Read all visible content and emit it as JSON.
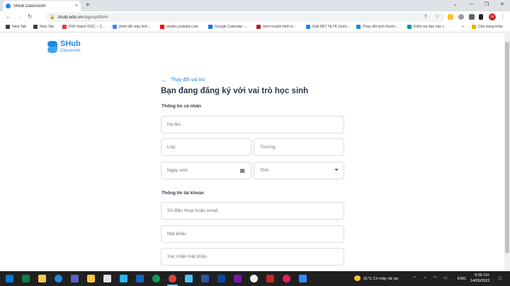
{
  "browser": {
    "tab_title": "SHub Classroom",
    "tab_close": "×",
    "new_tab": "+",
    "window_minimize": "—",
    "window_restore": "❐",
    "window_close": "✕",
    "tab_menu": "⌄",
    "url_host": "shub.edu.vn",
    "url_path": "/signup/form",
    "avatar_letter": "H",
    "bookmarks": [
      {
        "label": "New Tab",
        "icon": "globe-icon",
        "color": "#3c4043"
      },
      {
        "label": "New Tab",
        "icon": "globe-icon",
        "color": "#3c4043"
      },
      {
        "label": "PDF thành DOC – C...",
        "icon": "pdf-icon",
        "color": "#e53935"
      },
      {
        "label": "phím tắt máy tính...",
        "icon": "google-icon",
        "color": "#4285f4"
      },
      {
        "label": "studio.youtube.com",
        "icon": "youtube-icon",
        "color": "#ff0000"
      },
      {
        "label": "Google Calendar -...",
        "icon": "calendar-icon",
        "color": "#1a73e8"
      },
      {
        "label": "Xem truyện hình tr...",
        "icon": "book-icon",
        "color": "#b71c1c"
      },
      {
        "label": "Giải SBT NLTK (mới)...",
        "icon": "shub-icon",
        "color": "#1e88e5"
      },
      {
        "label": "Thay đổi kích thước...",
        "icon": "tag-icon",
        "color": "#1e88e5"
      },
      {
        "label": "Kiểm tra đạo văn |...",
        "icon": "check-icon",
        "color": "#0097a7"
      }
    ],
    "bookmarks_more": "»",
    "other_bookmarks": "Dấu trang khác"
  },
  "page": {
    "brand_name": "SHub",
    "brand_sub": "Classroom",
    "back_link": "Thay đổi vai trò",
    "heading": "Bạn đang đăng ký với vai trò học sinh",
    "section_personal": "Thông tin cá nhân",
    "section_account": "Thông tin tài khoản",
    "fields": {
      "full_name": "Họ tên",
      "class": "Lớp",
      "school": "Trường",
      "birthday": "Ngày sinh",
      "province": "Tỉnh",
      "phone_email": "Số điện thoại hoặc email",
      "password": "Mật khẩu",
      "confirm_password": "Xác nhận mật khẩu"
    }
  },
  "taskbar": {
    "weather": "31°C  Có mây rải rác",
    "language": "ENG",
    "time": "9:26 CH",
    "date": "14/09/2022"
  }
}
